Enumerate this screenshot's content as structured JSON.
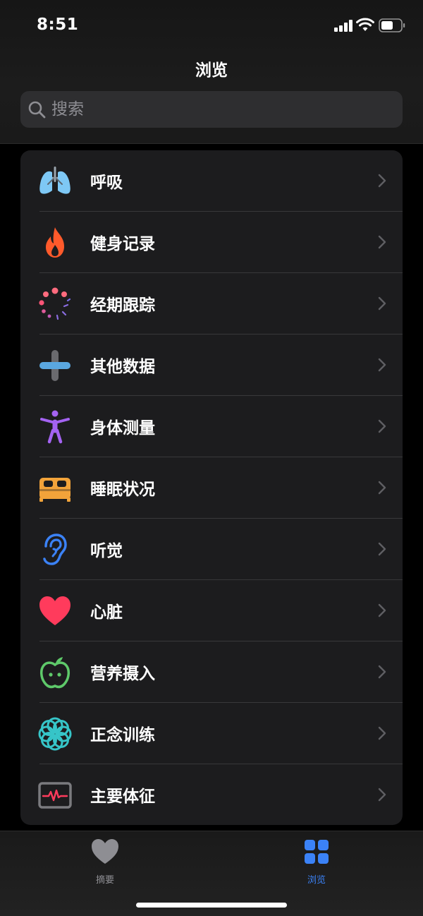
{
  "status": {
    "time": "8:51"
  },
  "nav": {
    "title": "浏览"
  },
  "search": {
    "placeholder": "搜索"
  },
  "categories": [
    {
      "label": "呼吸",
      "icon": "lungs-icon",
      "color": "#7ec8f5"
    },
    {
      "label": "健身记录",
      "icon": "flame-icon",
      "color": "#ff5a2b"
    },
    {
      "label": "经期跟踪",
      "icon": "cycle-dots-icon",
      "color": "#ff6b7e"
    },
    {
      "label": "其他数据",
      "icon": "plus-icon",
      "color": "#5aa7e0"
    },
    {
      "label": "身体测量",
      "icon": "figure-icon",
      "color": "#a463f2"
    },
    {
      "label": "睡眠状况",
      "icon": "bed-icon",
      "color": "#f2a33a"
    },
    {
      "label": "听觉",
      "icon": "ear-icon",
      "color": "#3b82f6"
    },
    {
      "label": "心脏",
      "icon": "heart-icon",
      "color": "#ff3b5c"
    },
    {
      "label": "营养摄入",
      "icon": "apple-icon",
      "color": "#5ec96a"
    },
    {
      "label": "正念训练",
      "icon": "mindfulness-flower-icon",
      "color": "#36c5c8"
    },
    {
      "label": "主要体征",
      "icon": "vitals-monitor-icon",
      "color": "#ff3b5c"
    }
  ],
  "tabs": [
    {
      "label": "摘要",
      "icon": "heart-icon",
      "active": false
    },
    {
      "label": "浏览",
      "icon": "grid-icon",
      "active": true
    }
  ]
}
